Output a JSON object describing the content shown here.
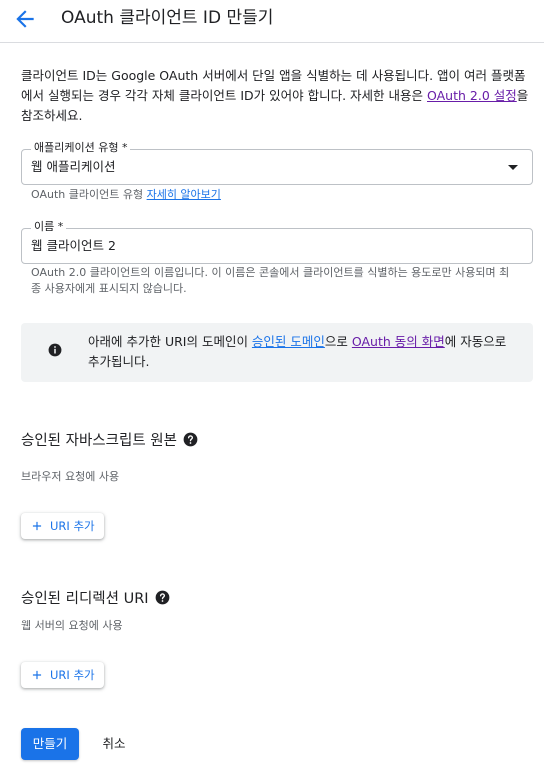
{
  "header": {
    "title": "OAuth 클라이언트 ID 만들기",
    "back_icon": "arrow-back-icon"
  },
  "intro": {
    "text_before": "클라이언트 ID는 Google OAuth 서버에서 단일 앱을 식별하는 데 사용됩니다. 앱이 여러 플랫폼에서 실행되는 경우 각각 자체 클라이언트 ID가 있어야 합니다. 자세한 내용은 ",
    "link": "OAuth 2.0 설정",
    "text_after": "을 참조하세요."
  },
  "app_type": {
    "label": "애플리케이션 유형 *",
    "value": "웹 애플리케이션",
    "hint_text": "OAuth 클라이언트 유형 ",
    "hint_link": "자세히 알아보기"
  },
  "name_field": {
    "label": "이름 *",
    "value": "웹 클라이언트 2",
    "hint": "OAuth 2.0 클라이언트의 이름입니다. 이 이름은 콘솔에서 클라이언트를 식별하는 용도로만 사용되며 최종 사용자에게 표시되지 않습니다."
  },
  "info": {
    "text_1": "아래에 추가한 URI의 도메인이 ",
    "link_1": "승인된 도메인",
    "text_2": "으로 ",
    "link_2": "OAuth 동의 화면",
    "text_3": "에 자동으로 추가됩니다."
  },
  "js_origins": {
    "title": "승인된 자바스크립트 원본",
    "desc": "브라우저 요청에 사용",
    "add_label": "URI 추가"
  },
  "redirect_uris": {
    "title": "승인된 리디렉션 URI",
    "desc": "웹 서버의 요청에 사용",
    "add_label": "URI 추가"
  },
  "actions": {
    "create_label": "만들기",
    "cancel_label": "취소"
  },
  "colors": {
    "accent": "#1a73e8",
    "visited_link": "#681da8",
    "info_bg": "#f1f3f4"
  }
}
